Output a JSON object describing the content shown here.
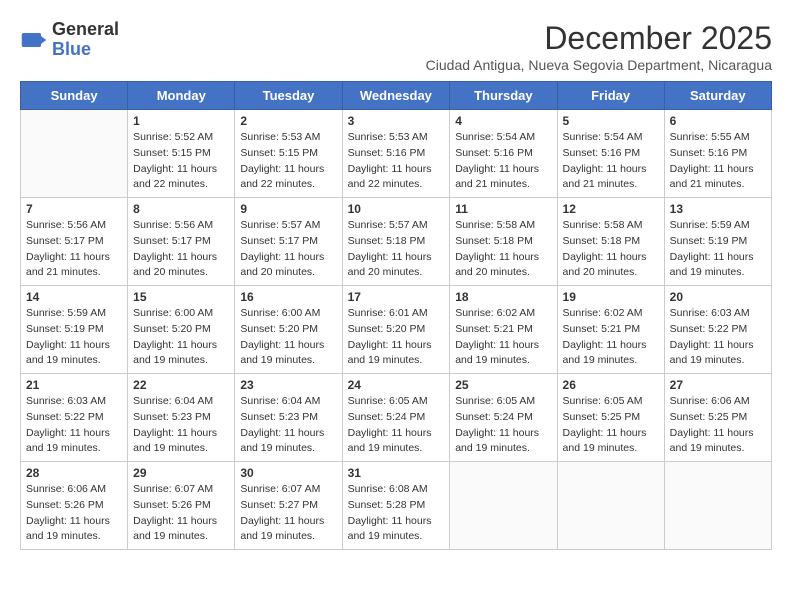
{
  "header": {
    "logo_line1": "General",
    "logo_line2": "Blue",
    "month_title": "December 2025",
    "subtitle": "Ciudad Antigua, Nueva Segovia Department, Nicaragua"
  },
  "weekdays": [
    "Sunday",
    "Monday",
    "Tuesday",
    "Wednesday",
    "Thursday",
    "Friday",
    "Saturday"
  ],
  "weeks": [
    [
      {
        "num": "",
        "info": ""
      },
      {
        "num": "1",
        "info": "Sunrise: 5:52 AM\nSunset: 5:15 PM\nDaylight: 11 hours\nand 22 minutes."
      },
      {
        "num": "2",
        "info": "Sunrise: 5:53 AM\nSunset: 5:15 PM\nDaylight: 11 hours\nand 22 minutes."
      },
      {
        "num": "3",
        "info": "Sunrise: 5:53 AM\nSunset: 5:16 PM\nDaylight: 11 hours\nand 22 minutes."
      },
      {
        "num": "4",
        "info": "Sunrise: 5:54 AM\nSunset: 5:16 PM\nDaylight: 11 hours\nand 21 minutes."
      },
      {
        "num": "5",
        "info": "Sunrise: 5:54 AM\nSunset: 5:16 PM\nDaylight: 11 hours\nand 21 minutes."
      },
      {
        "num": "6",
        "info": "Sunrise: 5:55 AM\nSunset: 5:16 PM\nDaylight: 11 hours\nand 21 minutes."
      }
    ],
    [
      {
        "num": "7",
        "info": "Sunrise: 5:56 AM\nSunset: 5:17 PM\nDaylight: 11 hours\nand 21 minutes."
      },
      {
        "num": "8",
        "info": "Sunrise: 5:56 AM\nSunset: 5:17 PM\nDaylight: 11 hours\nand 20 minutes."
      },
      {
        "num": "9",
        "info": "Sunrise: 5:57 AM\nSunset: 5:17 PM\nDaylight: 11 hours\nand 20 minutes."
      },
      {
        "num": "10",
        "info": "Sunrise: 5:57 AM\nSunset: 5:18 PM\nDaylight: 11 hours\nand 20 minutes."
      },
      {
        "num": "11",
        "info": "Sunrise: 5:58 AM\nSunset: 5:18 PM\nDaylight: 11 hours\nand 20 minutes."
      },
      {
        "num": "12",
        "info": "Sunrise: 5:58 AM\nSunset: 5:18 PM\nDaylight: 11 hours\nand 20 minutes."
      },
      {
        "num": "13",
        "info": "Sunrise: 5:59 AM\nSunset: 5:19 PM\nDaylight: 11 hours\nand 19 minutes."
      }
    ],
    [
      {
        "num": "14",
        "info": "Sunrise: 5:59 AM\nSunset: 5:19 PM\nDaylight: 11 hours\nand 19 minutes."
      },
      {
        "num": "15",
        "info": "Sunrise: 6:00 AM\nSunset: 5:20 PM\nDaylight: 11 hours\nand 19 minutes."
      },
      {
        "num": "16",
        "info": "Sunrise: 6:00 AM\nSunset: 5:20 PM\nDaylight: 11 hours\nand 19 minutes."
      },
      {
        "num": "17",
        "info": "Sunrise: 6:01 AM\nSunset: 5:20 PM\nDaylight: 11 hours\nand 19 minutes."
      },
      {
        "num": "18",
        "info": "Sunrise: 6:02 AM\nSunset: 5:21 PM\nDaylight: 11 hours\nand 19 minutes."
      },
      {
        "num": "19",
        "info": "Sunrise: 6:02 AM\nSunset: 5:21 PM\nDaylight: 11 hours\nand 19 minutes."
      },
      {
        "num": "20",
        "info": "Sunrise: 6:03 AM\nSunset: 5:22 PM\nDaylight: 11 hours\nand 19 minutes."
      }
    ],
    [
      {
        "num": "21",
        "info": "Sunrise: 6:03 AM\nSunset: 5:22 PM\nDaylight: 11 hours\nand 19 minutes."
      },
      {
        "num": "22",
        "info": "Sunrise: 6:04 AM\nSunset: 5:23 PM\nDaylight: 11 hours\nand 19 minutes."
      },
      {
        "num": "23",
        "info": "Sunrise: 6:04 AM\nSunset: 5:23 PM\nDaylight: 11 hours\nand 19 minutes."
      },
      {
        "num": "24",
        "info": "Sunrise: 6:05 AM\nSunset: 5:24 PM\nDaylight: 11 hours\nand 19 minutes."
      },
      {
        "num": "25",
        "info": "Sunrise: 6:05 AM\nSunset: 5:24 PM\nDaylight: 11 hours\nand 19 minutes."
      },
      {
        "num": "26",
        "info": "Sunrise: 6:05 AM\nSunset: 5:25 PM\nDaylight: 11 hours\nand 19 minutes."
      },
      {
        "num": "27",
        "info": "Sunrise: 6:06 AM\nSunset: 5:25 PM\nDaylight: 11 hours\nand 19 minutes."
      }
    ],
    [
      {
        "num": "28",
        "info": "Sunrise: 6:06 AM\nSunset: 5:26 PM\nDaylight: 11 hours\nand 19 minutes."
      },
      {
        "num": "29",
        "info": "Sunrise: 6:07 AM\nSunset: 5:26 PM\nDaylight: 11 hours\nand 19 minutes."
      },
      {
        "num": "30",
        "info": "Sunrise: 6:07 AM\nSunset: 5:27 PM\nDaylight: 11 hours\nand 19 minutes."
      },
      {
        "num": "31",
        "info": "Sunrise: 6:08 AM\nSunset: 5:28 PM\nDaylight: 11 hours\nand 19 minutes."
      },
      {
        "num": "",
        "info": ""
      },
      {
        "num": "",
        "info": ""
      },
      {
        "num": "",
        "info": ""
      }
    ]
  ]
}
